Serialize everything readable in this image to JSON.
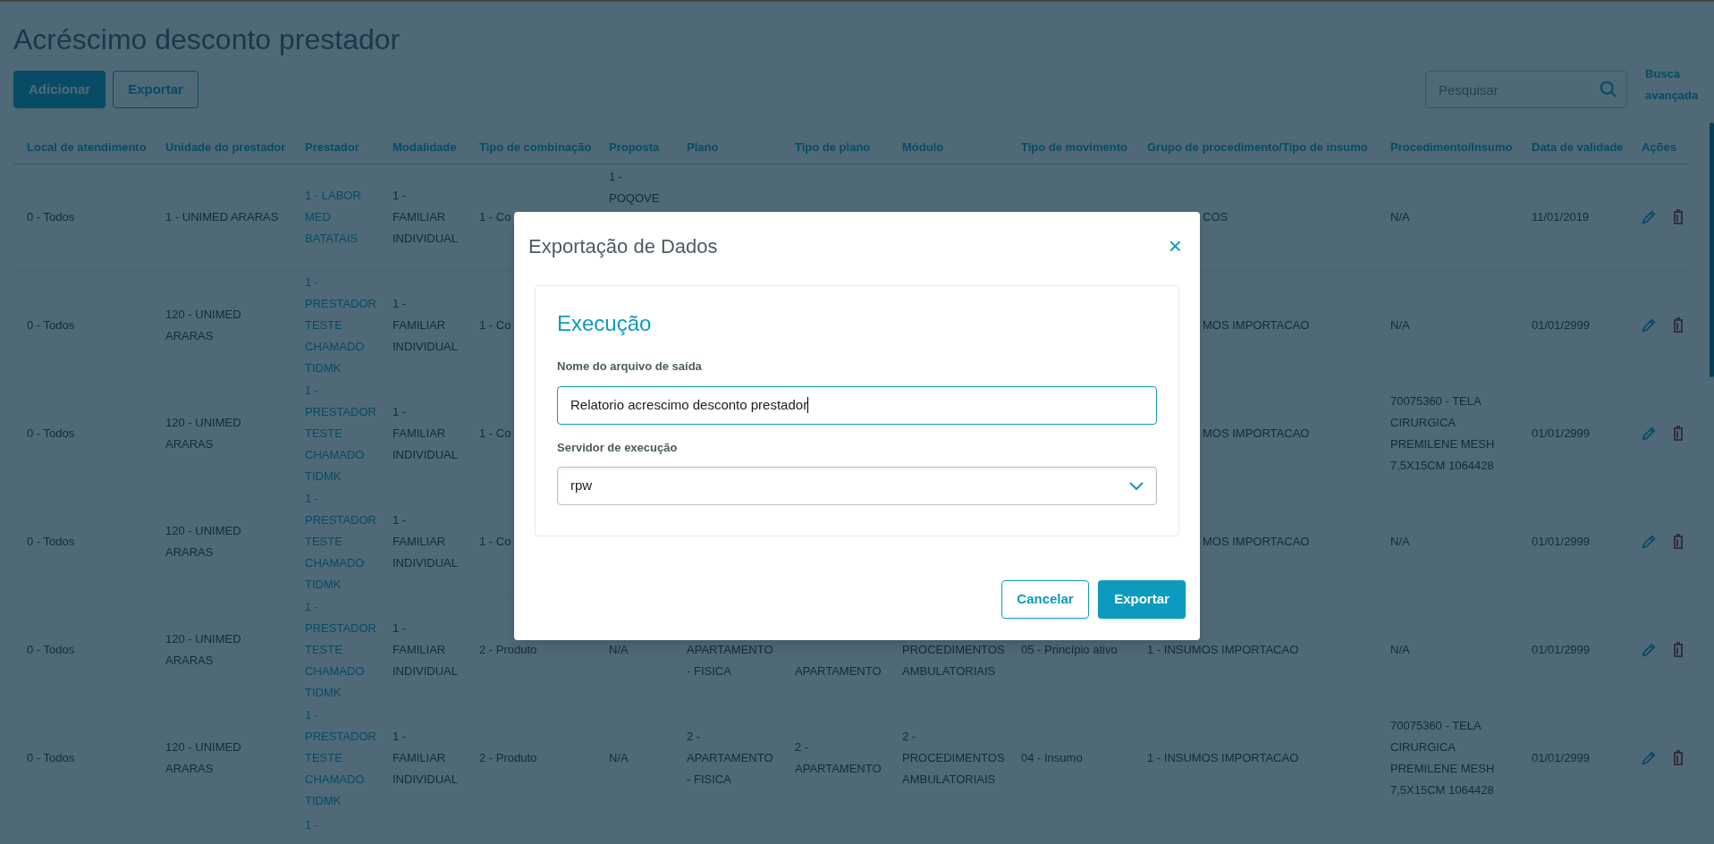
{
  "page": {
    "title": "Acréscimo desconto prestador",
    "actions": [
      {
        "label": "Adicionar",
        "kind": "primary"
      },
      {
        "label": "Exportar",
        "kind": "secondary"
      }
    ],
    "search": {
      "placeholder": "Pesquisar"
    },
    "advanced_search": "Busca avançada"
  },
  "table": {
    "columns": [
      {
        "label": "Local de atendimento",
        "kind": "text"
      },
      {
        "label": "Unidade do prestador",
        "kind": "text"
      },
      {
        "label": "Prestador",
        "kind": "link"
      },
      {
        "label": "Modalidade",
        "kind": "text"
      },
      {
        "label": "Tipo de combinação",
        "kind": "text"
      },
      {
        "label": "Proposta",
        "kind": "text"
      },
      {
        "label": "Plano",
        "kind": "text"
      },
      {
        "label": "Tipo de plano",
        "kind": "text"
      },
      {
        "label": "Módulo",
        "kind": "text"
      },
      {
        "label": "Tipo de movimento",
        "kind": "text"
      },
      {
        "label": "Grupo de procedimento/Tipo de insumo",
        "kind": "text"
      },
      {
        "label": "Procedimento/Insumo",
        "kind": "text"
      },
      {
        "label": "Data de validade",
        "kind": "text"
      },
      {
        "label": "Ações",
        "kind": "actions"
      }
    ],
    "rows": [
      {
        "cells": [
          "0 - Todos",
          "1 - UNIMED ARARAS",
          "1 - LABOR MED BATATAIS",
          "1 - FAMILIAR INDIVIDUAL",
          {
            "text": "1 - Co",
            "kind": "cut_end"
          },
          {
            "text": "1 - POQOVE",
            "kind": "cut_bottom"
          },
          null,
          null,
          null,
          null,
          {
            "text": "COS",
            "kind": "cut_start"
          },
          "N/A",
          "11/01/2019"
        ],
        "actions": true
      },
      {
        "cells": [
          "0 - Todos",
          "120 - UNIMED ARARAS",
          "1 - PRESTADOR TESTE CHAMADO TIDMK",
          "1 - FAMILIAR INDIVIDUAL",
          {
            "text": "1 - Co",
            "kind": "cut_end"
          },
          null,
          null,
          null,
          null,
          null,
          {
            "text": "MOS IMPORTACAO",
            "kind": "cut_start"
          },
          "N/A",
          "01/01/2999"
        ],
        "actions": true
      },
      {
        "cells": [
          "0 - Todos",
          "120 - UNIMED ARARAS",
          "1 - PRESTADOR TESTE CHAMADO TIDMK",
          "1 - FAMILIAR INDIVIDUAL",
          {
            "text": "1 - Co",
            "kind": "cut_end"
          },
          null,
          null,
          null,
          null,
          null,
          {
            "text": "MOS IMPORTACAO",
            "kind": "cut_start"
          },
          "70075360 - TELA CIRURGICA PREMILENE MESH 7,5X15CM 1064428",
          "01/01/2999"
        ],
        "actions": true
      },
      {
        "cells": [
          "0 - Todos",
          "120 - UNIMED ARARAS",
          "1 - PRESTADOR TESTE CHAMADO TIDMK",
          "1 - FAMILIAR INDIVIDUAL",
          {
            "text": "1 - Co",
            "kind": "cut_end"
          },
          null,
          null,
          null,
          null,
          null,
          {
            "text": "MOS IMPORTACAO",
            "kind": "cut_start"
          },
          "N/A",
          "01/01/2999"
        ],
        "actions": true
      },
      {
        "cells": [
          "0 - Todos",
          "120 - UNIMED ARARAS",
          "1 - PRESTADOR TESTE CHAMADO TIDMK",
          "1 - FAMILIAR INDIVIDUAL",
          "2 - Produto",
          "N/A",
          {
            "text": "APARTAMENTO - FISICA",
            "kind": "cut_top"
          },
          {
            "text": "APARTAMENTO",
            "kind": "cut_top"
          },
          {
            "text": "PROCEDIMENTOS AMBULATORIAIS",
            "kind": "cut_top"
          },
          "05 - Princípio ativo",
          "1 - INSUMOS IMPORTACAO",
          "N/A",
          "01/01/2999"
        ],
        "actions": true
      },
      {
        "cells": [
          "0 - Todos",
          "120 - UNIMED ARARAS",
          "1 - PRESTADOR TESTE CHAMADO TIDMK",
          "1 - FAMILIAR INDIVIDUAL",
          "2 - Produto",
          "N/A",
          "2 - APARTAMENTO - FISICA",
          "2 - APARTAMENTO",
          "2 - PROCEDIMENTOS AMBULATORIAIS",
          "04 - Insumo",
          "1 - INSUMOS IMPORTACAO",
          "70075360 - TELA CIRURGICA PREMILENE MESH 7,5X15CM 1064428",
          "01/01/2999"
        ],
        "actions": true
      },
      {
        "cells": [
          null,
          null,
          {
            "text": "1 -",
            "kind": "cut_bottom"
          },
          null,
          null,
          null,
          null,
          null,
          null,
          null,
          null,
          null,
          null
        ]
      }
    ]
  },
  "dialog": {
    "title": "Exportação de Dados",
    "close": "×",
    "section": "Execução",
    "fields": [
      {
        "label": "Nome do arquivo de saída",
        "kind": "text",
        "value": "Relatorio acrescimo desconto prestador",
        "focused": true
      },
      {
        "label": "Servidor de execução",
        "kind": "select",
        "value": "rpw",
        "focused": false
      }
    ],
    "buttons": [
      {
        "label": "Cancelar",
        "kind": "secondary"
      },
      {
        "label": "Exportar",
        "kind": "primary"
      }
    ]
  }
}
